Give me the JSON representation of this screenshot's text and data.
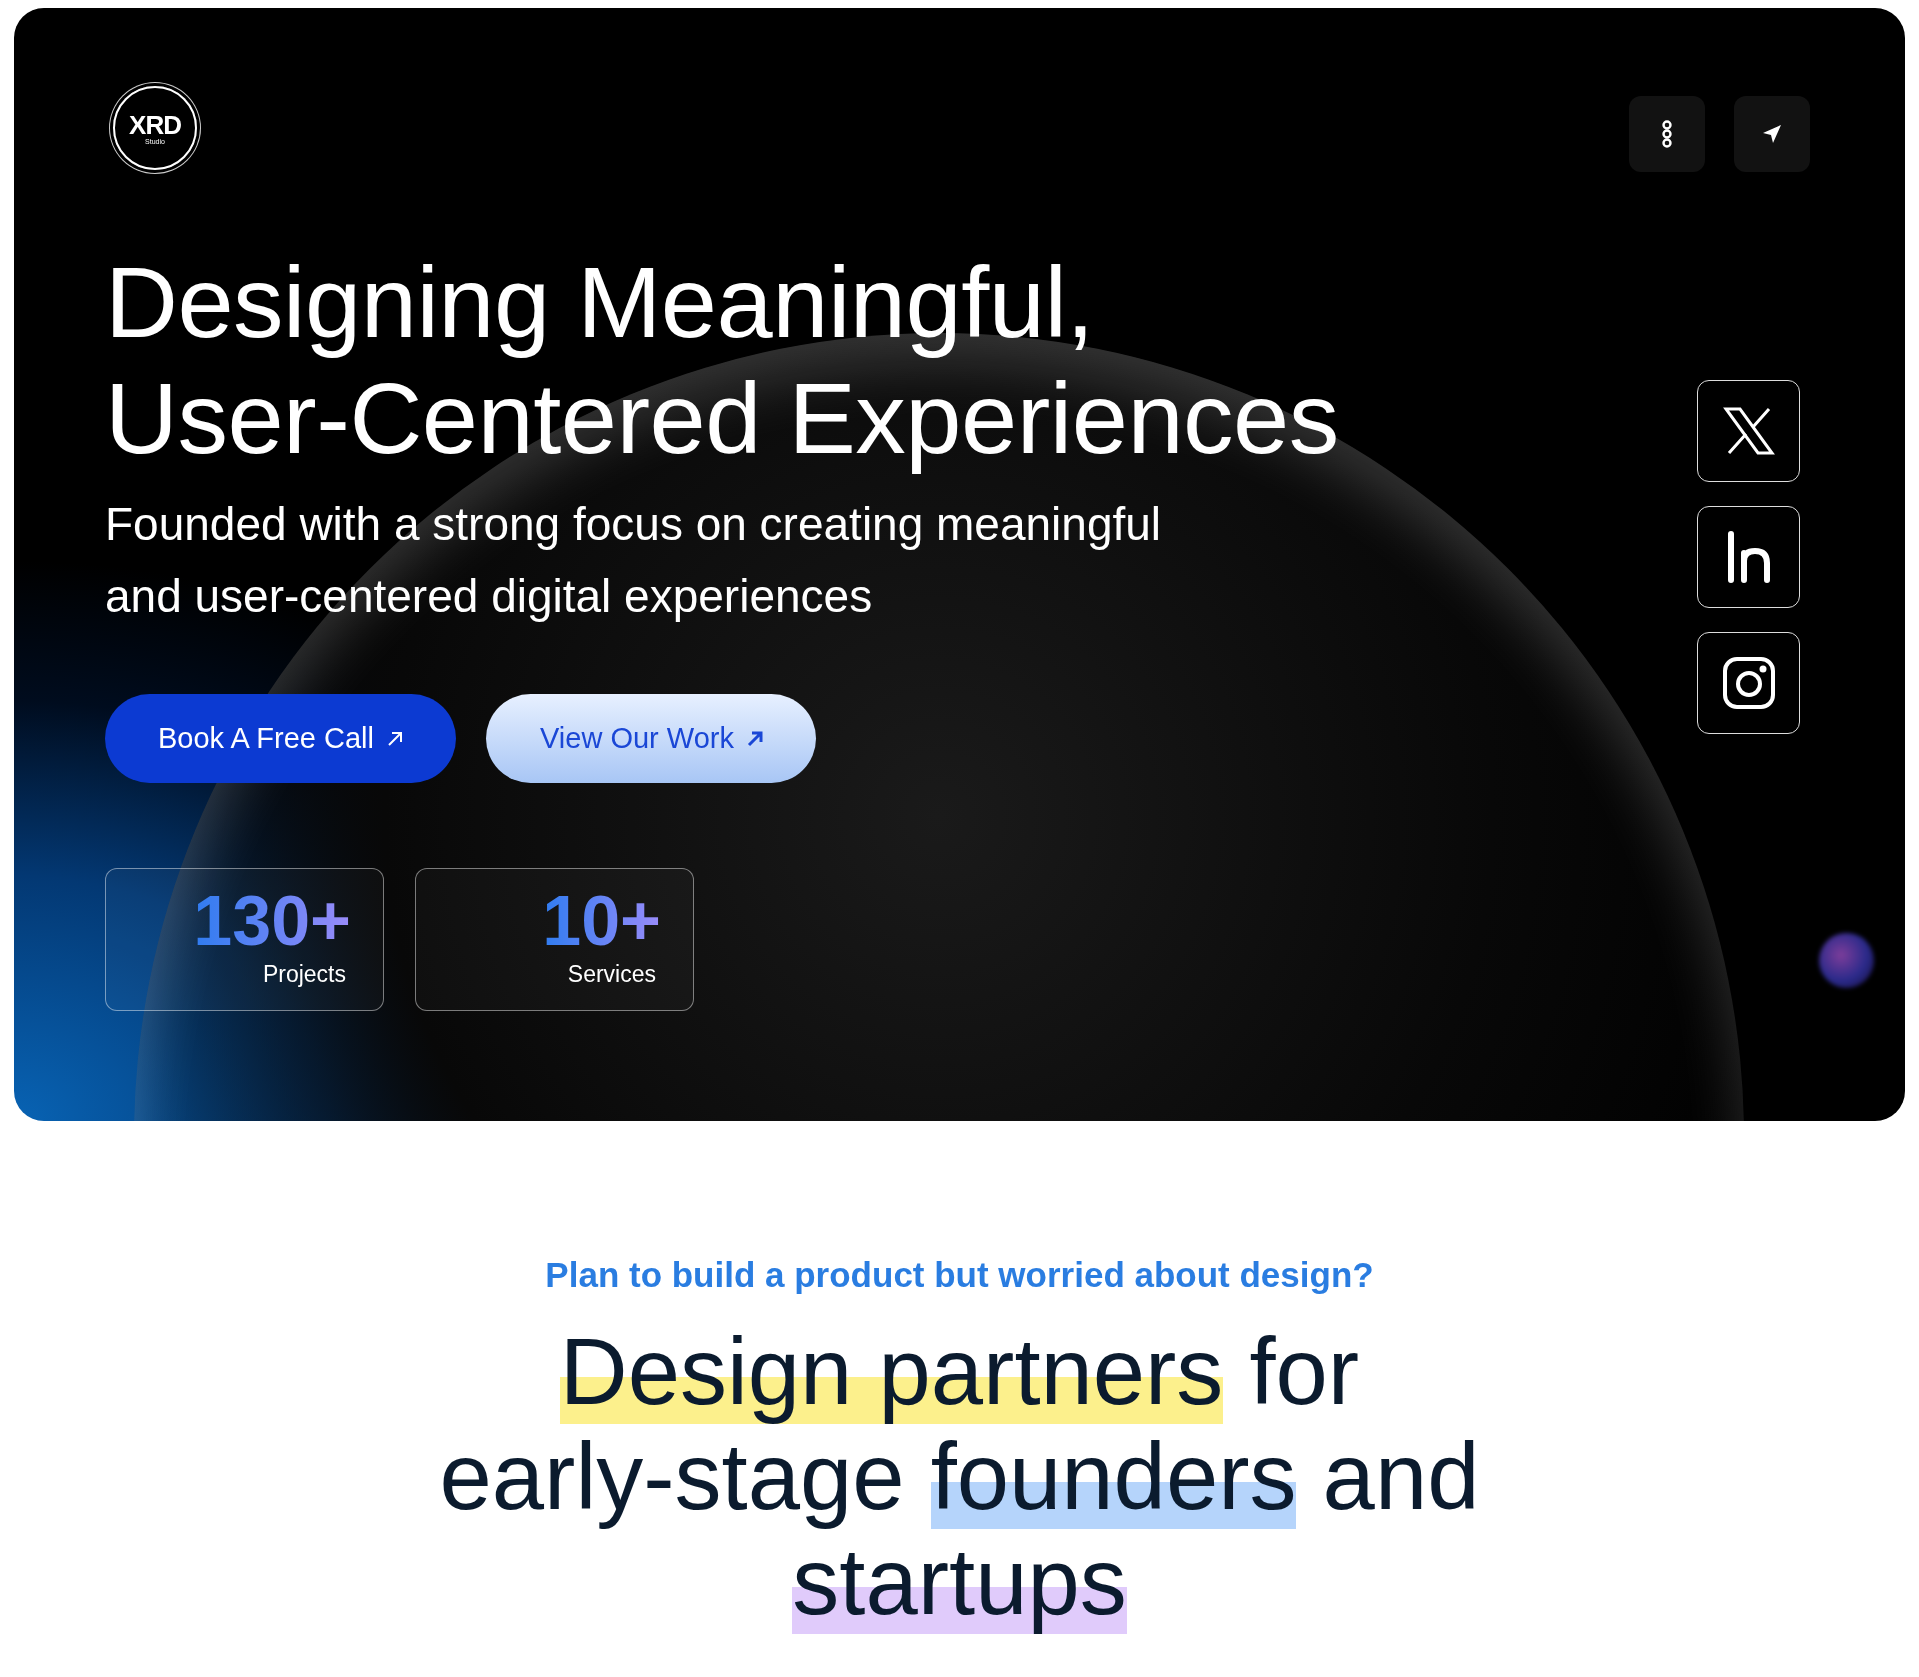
{
  "header": {
    "logo": {
      "mark": "XRD",
      "sub": "Studio"
    },
    "actions": [
      {
        "kind": "menu"
      },
      {
        "kind": "send"
      }
    ]
  },
  "hero": {
    "title_lines": [
      "Designing Meaningful,",
      "User-Centered Experiences"
    ],
    "subtitle": "Founded with a strong focus on creating meaningful and user-centered digital experiences",
    "buttons": [
      {
        "label": "Book A Free Call",
        "kind": "primary"
      },
      {
        "label": "View Our Work",
        "kind": "secondary"
      }
    ],
    "stats": [
      {
        "value": "130+",
        "label": "Projects"
      },
      {
        "value": "10+",
        "label": "Services"
      }
    ],
    "socials": [
      {
        "kind": "x"
      },
      {
        "kind": "linkedin"
      },
      {
        "kind": "instagram"
      }
    ]
  },
  "intro": {
    "tagline": "Plan to build a product but worried about design?",
    "heading_lines": [
      [
        {
          "text": "Design partners",
          "color": "#fcf08c"
        },
        {
          "text": " for"
        }
      ],
      [
        {
          "text": "early-stage "
        },
        {
          "text": "founders",
          "color": "#b5d4fb"
        },
        {
          "text": " and"
        }
      ],
      [
        {
          "text": "startups",
          "color": "#e0cbfb"
        }
      ]
    ]
  }
}
